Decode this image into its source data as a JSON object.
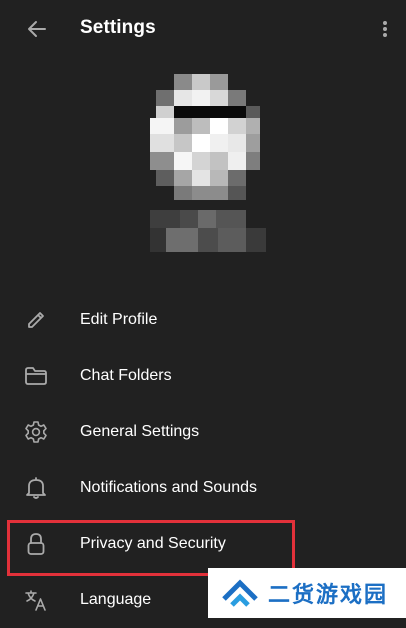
{
  "header": {
    "title": "Settings",
    "back_icon": "arrow-left-icon",
    "more_icon": "more-vertical-icon"
  },
  "menu": {
    "items": [
      {
        "label": "Edit Profile",
        "icon": "pencil-icon"
      },
      {
        "label": "Chat Folders",
        "icon": "folder-icon"
      },
      {
        "label": "General Settings",
        "icon": "gear-icon"
      },
      {
        "label": "Notifications and Sounds",
        "icon": "bell-icon"
      },
      {
        "label": "Privacy and Security",
        "icon": "lock-icon",
        "highlighted": true
      },
      {
        "label": "Language",
        "icon": "translate-icon"
      }
    ]
  },
  "watermark": {
    "text": "二货游戏园"
  },
  "colors": {
    "background": "#212121",
    "text": "#ffffff",
    "icon": "#aaaaaa",
    "highlight": "#e2313a",
    "watermark_text": "#1c6fc4"
  }
}
